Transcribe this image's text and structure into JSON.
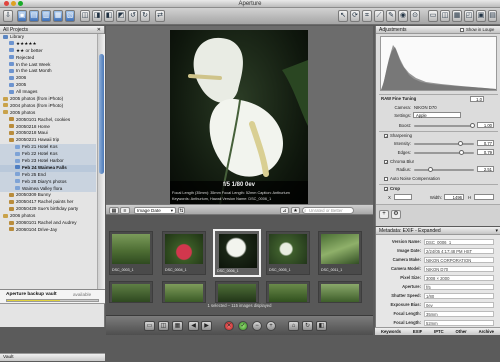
{
  "window": {
    "title": "Aperture"
  },
  "projects_panel": {
    "title": "All Projects",
    "items": [
      {
        "label": "Library"
      },
      {
        "label": "★★★★★"
      },
      {
        "label": "★★ or better"
      },
      {
        "label": "Rejected"
      },
      {
        "label": "In the Last Week"
      },
      {
        "label": "In the Last Month"
      },
      {
        "label": "2006"
      },
      {
        "label": "2005"
      },
      {
        "label": "All Images"
      },
      {
        "label": "2005 photos (from iPhoto)"
      },
      {
        "label": "2004 photos (from iPhoto)"
      },
      {
        "label": "2005 photos"
      },
      {
        "label": "20050101 Rachel, cookies"
      },
      {
        "label": "20050218 Home"
      },
      {
        "label": "20050218 Maui"
      },
      {
        "label": "20050221 Hawaii trip"
      },
      {
        "label": "Feb 21 Hotel Kos"
      },
      {
        "label": "Feb 22 Hotel Kos"
      },
      {
        "label": "Feb 23 Hotel Harbor"
      },
      {
        "label": "Feb 24 Waimea Falls"
      },
      {
        "label": "Feb 25 End"
      },
      {
        "label": "Feb 28 Diary's photos"
      },
      {
        "label": "Waimea Valley flora"
      },
      {
        "label": "20050309 Bunny"
      },
      {
        "label": "20050417 Rachel paints her"
      },
      {
        "label": "20050429 Sue's birthday party"
      },
      {
        "label": "2006 photos"
      },
      {
        "label": "20060101 Rachel and Audrey"
      },
      {
        "label": "20060104 Drive-Jay"
      }
    ],
    "vault": {
      "label": "Aperture backup vault",
      "status": "available",
      "fill": 0.58
    },
    "footer_tab": "Vault"
  },
  "viewer": {
    "hud": {
      "exposure": "f/5 1/80 0ev",
      "line1": "Focal Length (35mm): 35mm   Focal Length: 52mm   Caption: Anthurium",
      "line2": "Keywords: Anthurium, Hawaii   Version Name: DSC_0006_1"
    }
  },
  "browser": {
    "sort": "Image Date",
    "search_placeholder": "Unrated or Better",
    "thumbs": [
      {
        "caption": "DSC_0003_1"
      },
      {
        "caption": "DSC_0004_1"
      },
      {
        "caption": "DSC_0006_1"
      },
      {
        "caption": "DSC_0005_1"
      },
      {
        "caption": "DSC_0011_1"
      },
      {
        "caption": "DSC_0010_1"
      }
    ],
    "status": "1 selected – 115 images displayed"
  },
  "adjustments": {
    "title": "Adjustments",
    "show_in_loupe": "Show in Loupe",
    "raw_tuning": "RAW Fine Tuning",
    "raw_version": "1.0",
    "camera_label": "Camera:",
    "camera_value": "NIKON D70",
    "settings_label": "Settings:",
    "settings_value": "Apple",
    "boost_label": "Boost:",
    "boost_value": "1.00",
    "sharpening_label": "Sharpening",
    "intensity_label": "Intensity:",
    "intensity_value": "0.77",
    "edges_label": "Edges:",
    "edges_value": "0.79",
    "chroma_label": "Chroma Blur",
    "radius_label": "Radius:",
    "radius_value": "2.51",
    "moire_label": "Auto Noise Compensation",
    "crop_label": "Crop",
    "crop_x": "X",
    "crop_width": "Width:",
    "crop_w_value": "1496",
    "crop_h_label": "H"
  },
  "metadata": {
    "title": "Metadata: EXIF - Expanded",
    "rows": [
      {
        "key": "Version Name:",
        "value": "DSC_0006_1"
      },
      {
        "key": "Image Date:",
        "value": "2/24/05 4:17:48 PM HST"
      },
      {
        "key": "Camera Make:",
        "value": "NIKON CORPORATION"
      },
      {
        "key": "Camera Model:",
        "value": "NIKON D70"
      },
      {
        "key": "Pixel Size:",
        "value": "3008 × 2000"
      },
      {
        "key": "Aperture:",
        "value": "f/5"
      },
      {
        "key": "Shutter Speed:",
        "value": "1/80"
      },
      {
        "key": "Exposure Bias:",
        "value": "0ev"
      },
      {
        "key": "Focal Length:",
        "value": "35mm"
      },
      {
        "key": "Focal Length:",
        "value": "52mm"
      }
    ],
    "tabs": [
      "Keywords",
      "EXIF",
      "IPTC",
      "Other",
      "Archive"
    ]
  }
}
